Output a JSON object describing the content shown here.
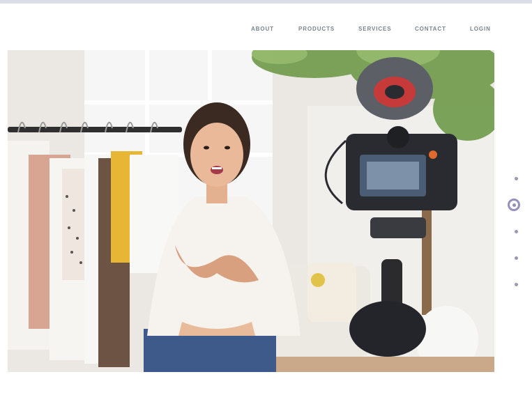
{
  "nav": {
    "items": [
      {
        "label": "ABOUT"
      },
      {
        "label": "PRODUCTS"
      },
      {
        "label": "SERVICES"
      },
      {
        "label": "CONTACT"
      },
      {
        "label": "LOGIN"
      }
    ]
  },
  "hero": {
    "image_subject": "woman-vlogging-to-camera-beside-clothing-rack"
  },
  "slider": {
    "dot_count": 5,
    "active_index": 1
  },
  "colors": {
    "nav_text": "#7a8590",
    "top_strip": "#dcdce8",
    "pager_accent": "#9491bd"
  }
}
